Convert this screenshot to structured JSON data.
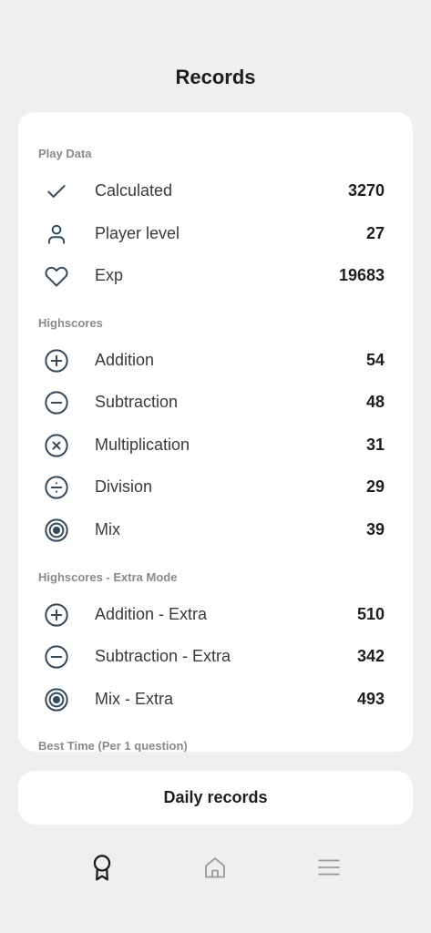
{
  "header": {
    "title": "Records"
  },
  "sections": {
    "play_data": "Play Data",
    "highscores": "Highscores",
    "extra": "Highscores - Extra Mode",
    "best_time": "Best Time (Per 1 question)"
  },
  "play_data": [
    {
      "icon": "check-icon",
      "label": "Calculated",
      "value": "3270"
    },
    {
      "icon": "person-icon",
      "label": "Player level",
      "value": "27"
    },
    {
      "icon": "heart-icon",
      "label": "Exp",
      "value": "19683"
    }
  ],
  "highscores": [
    {
      "icon": "plus-circle-icon",
      "label": "Addition",
      "value": "54"
    },
    {
      "icon": "minus-circle-icon",
      "label": "Subtraction",
      "value": "48"
    },
    {
      "icon": "times-circle-icon",
      "label": "Multiplication",
      "value": "31"
    },
    {
      "icon": "divide-circle-icon",
      "label": "Division",
      "value": "29"
    },
    {
      "icon": "target-icon",
      "label": "Mix",
      "value": "39"
    }
  ],
  "extra": [
    {
      "icon": "plus-circle-icon",
      "label": "Addition - Extra",
      "value": "510"
    },
    {
      "icon": "minus-circle-icon",
      "label": "Subtraction - Extra",
      "value": "342"
    },
    {
      "icon": "target-icon",
      "label": "Mix - Extra",
      "value": "493"
    }
  ],
  "buttons": {
    "daily": "Daily records"
  },
  "colors": {
    "icon": "#34495a",
    "background": "#efefef",
    "card": "#ffffff"
  },
  "nav": [
    {
      "icon": "award-icon",
      "active": true
    },
    {
      "icon": "home-icon",
      "active": false
    },
    {
      "icon": "menu-icon",
      "active": false
    }
  ]
}
